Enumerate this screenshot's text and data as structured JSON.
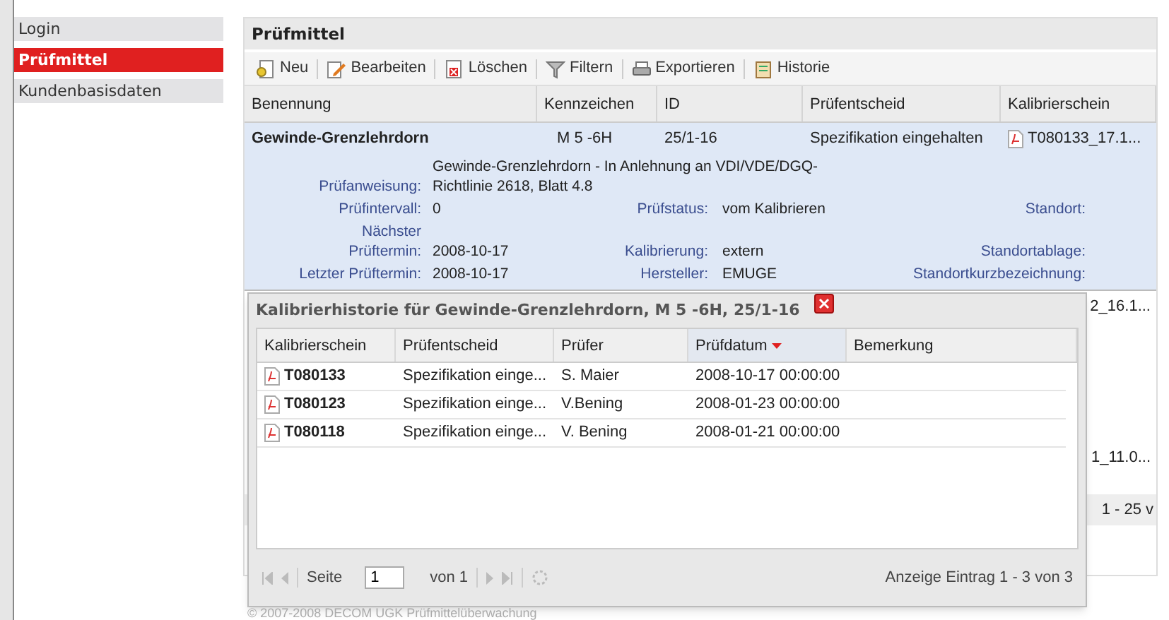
{
  "sidebar": {
    "items": [
      {
        "label": "Login",
        "selected": false
      },
      {
        "label": "Prüfmittel",
        "selected": true
      },
      {
        "label": "Kundenbasisdaten",
        "selected": false
      }
    ]
  },
  "panel": {
    "title": "Prüfmittel",
    "toolbar": [
      {
        "kind": "new",
        "label": "Neu"
      },
      {
        "kind": "edit",
        "label": "Bearbeiten"
      },
      {
        "kind": "delete",
        "label": "Löschen"
      },
      {
        "kind": "filter",
        "label": "Filtern"
      },
      {
        "kind": "export",
        "label": "Exportieren"
      },
      {
        "kind": "history",
        "label": "Historie"
      }
    ],
    "table": {
      "columns": [
        "Benennung",
        "Kennzeichen",
        "ID",
        "Prüfentscheid",
        "Kalibrierschein"
      ],
      "expanded_row": {
        "cells": [
          "Gewinde-Grenzlehrdorn",
          "M 5 -6H",
          "25/1-16",
          "Spezifikation eingehalten",
          "T080133_17.1..."
        ],
        "details": [
          {
            "label": "Prüfanweisung:",
            "value": "Gewinde-Grenzlehrdorn - In Anlehnung an VDI/VDE/DGQ-Richtlinie 2618, Blatt 4.8"
          },
          {
            "label": "Prüfintervall:",
            "value": "0",
            "label_2": "Prüfstatus:",
            "value_2": "vom Kalibrieren",
            "label_3": "Standort:"
          },
          {
            "label": "Nächster Prüftermin:",
            "value": "2008-10-17",
            "label_2": "Kalibrierung:",
            "value_2": "extern",
            "label_3": "Standortablage:"
          },
          {
            "label": "Letzter Prüftermin:",
            "value": "2008-10-17",
            "label_2": "Hersteller:",
            "value_2": "EMUGE",
            "label_3": "Standortkurzbezeichnung:"
          }
        ]
      },
      "partial_rows": [
        "2_16.1...",
        "1_11.0..."
      ],
      "paging_text": "1 - 25 v"
    }
  },
  "dialog": {
    "title": "Kalibrierhistorie für Gewinde-Grenzlehrdorn, M 5 -6H, 25/1-16",
    "columns": [
      {
        "label": "Kalibrierschein",
        "sorted": false
      },
      {
        "label": "Prüfentscheid",
        "sorted": false
      },
      {
        "label": "Prüfer",
        "sorted": false
      },
      {
        "label": "Prüfdatum",
        "sorted": true
      },
      {
        "label": "Bemerkung",
        "sorted": false
      }
    ],
    "rows": [
      {
        "certificate": "T080133",
        "decision": "Spezifikation einge...",
        "inspector": "S. Maier",
        "date": "2008-10-17 00:00:00"
      },
      {
        "certificate": "T080123",
        "decision": "Spezifikation einge...",
        "inspector": "V.Bening",
        "date": "2008-01-23 00:00:00"
      },
      {
        "certificate": "T080118",
        "decision": "Spezifikation einge...",
        "inspector": "V. Bening",
        "date": "2008-01-21 00:00:00"
      }
    ],
    "pager": {
      "page_label": "Seite",
      "page": "1",
      "page_count": "von 1",
      "summary": "Anzeige Eintrag 1 - 3 von 3"
    }
  },
  "footer": "© 2007-2008 DECOM UGK Prüfmittelüberwachung"
}
